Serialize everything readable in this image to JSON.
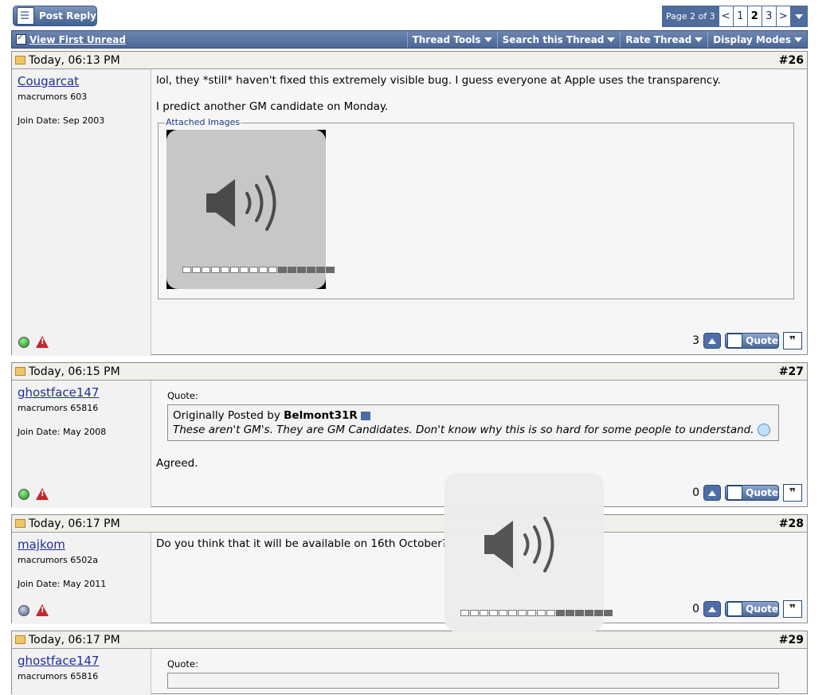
{
  "top": {
    "post_reply_label": "Post Reply",
    "pagination": {
      "label": "Page 2 of 3",
      "prev": "<",
      "pages": [
        "1",
        "2",
        "3"
      ],
      "current": "2",
      "next": ">"
    }
  },
  "toolbar": {
    "view_first_unread": "View First Unread",
    "menus": [
      "Thread Tools",
      "Search this Thread",
      "Rate Thread",
      "Display Modes"
    ]
  },
  "posts": [
    {
      "date": "Today, 06:13 PM",
      "number": "#26",
      "username": "Cougarcat",
      "user_title": "macrumors 603",
      "join_date": "Join Date: Sep 2003",
      "online": true,
      "lines": [
        "lol, they *still* haven't fixed this extremely visible bug. I guess everyone at Apple uses the transparency.",
        "I predict another GM candidate on Monday."
      ],
      "attach_label": "Attached Images",
      "votes": "3"
    },
    {
      "date": "Today, 06:15 PM",
      "number": "#27",
      "username": "ghostface147",
      "user_title": "macrumors 65816",
      "join_date": "Join Date: May 2008",
      "online": true,
      "quote_label": "Quote:",
      "quote_prefix": "Originally Posted by ",
      "quote_author": "Belmont31R",
      "quote_text": "These aren't GM's. They are GM Candidates. Don't know why this is so hard for some people to understand.",
      "reply": "Agreed.",
      "votes": "0"
    },
    {
      "date": "Today, 06:17 PM",
      "number": "#28",
      "username": "majkom",
      "user_title": "macrumors 6502a",
      "join_date": "Join Date: May 2011",
      "online": false,
      "line": "Do you think that it will be available on 16th October?",
      "votes": "0"
    },
    {
      "date": "Today, 06:17 PM",
      "number": "#29",
      "username": "ghostface147",
      "user_title": "macrumors 65816",
      "quote_label": "Quote:"
    }
  ],
  "buttons": {
    "quote_label": "Quote",
    "multiquote_glyph": "❞"
  },
  "volume": {
    "segments": 16,
    "level": 0.375
  }
}
